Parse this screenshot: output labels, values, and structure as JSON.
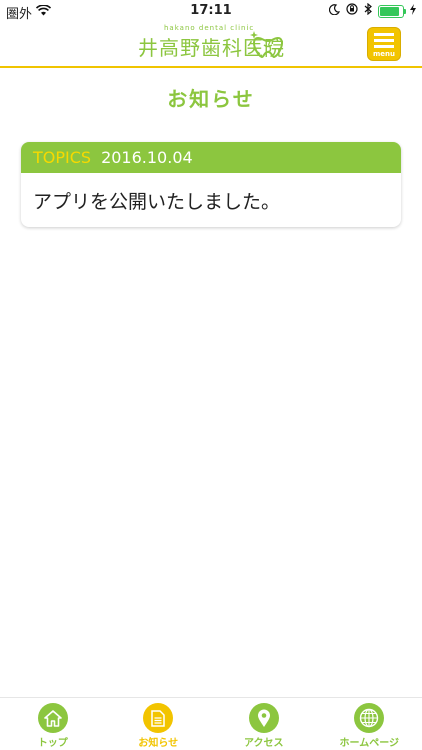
{
  "status_bar": {
    "carrier": "圏外",
    "time": "17:11",
    "battery_level": 0.95
  },
  "header": {
    "logo_subtitle": "hakano dental clinic",
    "logo_name": "井高野歯科医院",
    "menu_label": "menu"
  },
  "page": {
    "title": "お知らせ"
  },
  "news": [
    {
      "tag": "TOPICS",
      "date": "2016.10.04",
      "text": "アプリを公開いたしました。"
    }
  ],
  "tabs": [
    {
      "label": "トップ",
      "icon": "home-icon",
      "active": false
    },
    {
      "label": "お知らせ",
      "icon": "document-icon",
      "active": true
    },
    {
      "label": "アクセス",
      "icon": "location-pin-icon",
      "active": false
    },
    {
      "label": "ホームページ",
      "icon": "globe-icon",
      "active": false
    }
  ],
  "colors": {
    "brand_green": "#8cc63f",
    "accent_yellow": "#f2c400",
    "tag_yellow": "#f7d900"
  }
}
